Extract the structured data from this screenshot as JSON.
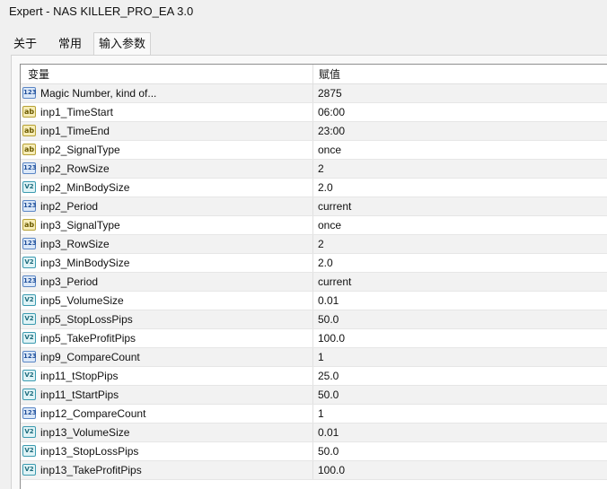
{
  "window": {
    "title": "Expert - NAS KILLER_PRO_EA 3.0"
  },
  "tabs": [
    {
      "label": "关于"
    },
    {
      "label": "常用"
    },
    {
      "label": "输入参数"
    }
  ],
  "grid": {
    "columns": {
      "variable": "变量",
      "value": "赋值"
    },
    "rows": [
      {
        "type": "int",
        "icon_text": "123",
        "name": "Magic Number, kind of...",
        "value": "2875"
      },
      {
        "type": "string",
        "icon_text": "ab",
        "name": "inp1_TimeStart",
        "value": "06:00"
      },
      {
        "type": "string",
        "icon_text": "ab",
        "name": "inp1_TimeEnd",
        "value": "23:00"
      },
      {
        "type": "string",
        "icon_text": "ab",
        "name": "inp2_SignalType",
        "value": "once"
      },
      {
        "type": "int",
        "icon_text": "123",
        "name": "inp2_RowSize",
        "value": "2"
      },
      {
        "type": "double",
        "icon_text": "V2",
        "name": "inp2_MinBodySize",
        "value": "2.0"
      },
      {
        "type": "int",
        "icon_text": "123",
        "name": "inp2_Period",
        "value": "current"
      },
      {
        "type": "string",
        "icon_text": "ab",
        "name": "inp3_SignalType",
        "value": "once"
      },
      {
        "type": "int",
        "icon_text": "123",
        "name": "inp3_RowSize",
        "value": "2"
      },
      {
        "type": "double",
        "icon_text": "V2",
        "name": "inp3_MinBodySize",
        "value": "2.0"
      },
      {
        "type": "int",
        "icon_text": "123",
        "name": "inp3_Period",
        "value": "current"
      },
      {
        "type": "double",
        "icon_text": "V2",
        "name": "inp5_VolumeSize",
        "value": "0.01"
      },
      {
        "type": "double",
        "icon_text": "V2",
        "name": "inp5_StopLossPips",
        "value": "50.0"
      },
      {
        "type": "double",
        "icon_text": "V2",
        "name": "inp5_TakeProfitPips",
        "value": "100.0"
      },
      {
        "type": "int",
        "icon_text": "123",
        "name": "inp9_CompareCount",
        "value": "1"
      },
      {
        "type": "double",
        "icon_text": "V2",
        "name": "inp11_tStopPips",
        "value": "25.0"
      },
      {
        "type": "double",
        "icon_text": "V2",
        "name": "inp11_tStartPips",
        "value": "50.0"
      },
      {
        "type": "int",
        "icon_text": "123",
        "name": "inp12_CompareCount",
        "value": "1"
      },
      {
        "type": "double",
        "icon_text": "V2",
        "name": "inp13_VolumeSize",
        "value": "0.01"
      },
      {
        "type": "double",
        "icon_text": "V2",
        "name": "inp13_StopLossPips",
        "value": "50.0"
      },
      {
        "type": "double",
        "icon_text": "V2",
        "name": "inp13_TakeProfitPips",
        "value": "100.0"
      }
    ]
  }
}
